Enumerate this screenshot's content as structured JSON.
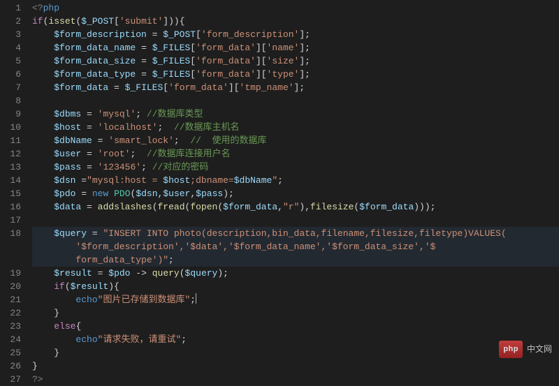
{
  "lines": [
    {
      "n": "1",
      "h": "<span class='tag'>&lt;?</span><span class='kw'>php</span>"
    },
    {
      "n": "2",
      "h": "<span class='ctrl'>if</span><span class='pun'>(</span><span class='func'>isset</span><span class='pun'>(</span><span class='var'>$_POST</span><span class='pun'>[</span><span class='str'>'submit'</span><span class='pun'>])){</span>"
    },
    {
      "n": "3",
      "h": "    <span class='var'>$form_description</span> <span class='op'>=</span> <span class='var'>$_POST</span><span class='pun'>[</span><span class='str'>'form_description'</span><span class='pun'>];</span>"
    },
    {
      "n": "4",
      "h": "    <span class='var'>$form_data_name</span> <span class='op'>=</span> <span class='var'>$_FILES</span><span class='pun'>[</span><span class='str'>'form_data'</span><span class='pun'>][</span><span class='str'>'name'</span><span class='pun'>];</span>"
    },
    {
      "n": "5",
      "h": "    <span class='var'>$form_data_size</span> <span class='op'>=</span> <span class='var'>$_FILES</span><span class='pun'>[</span><span class='str'>'form_data'</span><span class='pun'>][</span><span class='str'>'size'</span><span class='pun'>];</span>"
    },
    {
      "n": "6",
      "h": "    <span class='var'>$form_data_type</span> <span class='op'>=</span> <span class='var'>$_FILES</span><span class='pun'>[</span><span class='str'>'form_data'</span><span class='pun'>][</span><span class='str'>'type'</span><span class='pun'>];</span>"
    },
    {
      "n": "7",
      "h": "    <span class='var'>$form_data</span> <span class='op'>=</span> <span class='var'>$_FILES</span><span class='pun'>[</span><span class='str'>'form_data'</span><span class='pun'>][</span><span class='str'>'tmp_name'</span><span class='pun'>];</span>"
    },
    {
      "n": "8",
      "h": ""
    },
    {
      "n": "9",
      "h": "    <span class='var'>$dbms</span> <span class='op'>=</span> <span class='str'>'mysql'</span><span class='pun'>;</span> <span class='cmt'>//数据库类型</span>"
    },
    {
      "n": "10",
      "h": "    <span class='var'>$host</span> <span class='op'>=</span> <span class='str'>'localhost'</span><span class='pun'>;</span>  <span class='cmt'>//数据库主机名</span>"
    },
    {
      "n": "11",
      "h": "    <span class='var'>$dbName</span> <span class='op'>=</span> <span class='str'>'smart_lock'</span><span class='pun'>;</span>  <span class='cmt'>//  使用的数据库</span>"
    },
    {
      "n": "12",
      "h": "    <span class='var'>$user</span> <span class='op'>=</span> <span class='str'>'root'</span><span class='pun'>;</span>  <span class='cmt'>//数据库连接用户名</span>"
    },
    {
      "n": "13",
      "h": "    <span class='var'>$pass</span> <span class='op'>=</span> <span class='str'>'123456'</span><span class='pun'>;</span> <span class='cmt'>//对应的密码</span>"
    },
    {
      "n": "14",
      "h": "    <span class='var'>$dsn</span> <span class='op'>=</span><span class='str'>\"mysql:host = </span><span class='var'>$host</span><span class='str'>;dbname=</span><span class='var'>$dbName</span><span class='str'>\"</span><span class='pun'>;</span>"
    },
    {
      "n": "15",
      "h": "    <span class='var'>$pdo</span> <span class='op'>=</span> <span class='kw'>new</span> <span class='type'>PDO</span><span class='pun'>(</span><span class='var'>$dsn</span><span class='pun'>,</span><span class='var'>$user</span><span class='pun'>,</span><span class='var'>$pass</span><span class='pun'>);</span>"
    },
    {
      "n": "16",
      "h": "    <span class='var'>$data</span> <span class='op'>=</span> <span class='func'>addslashes</span><span class='pun'>(</span><span class='func'>fread</span><span class='pun'>(</span><span class='func'>fopen</span><span class='pun'>(</span><span class='var'>$form_data</span><span class='pun'>,</span><span class='str'>\"r\"</span><span class='pun'>),</span><span class='func'>filesize</span><span class='pun'>(</span><span class='var'>$form_data</span><span class='pun'>)));</span>"
    },
    {
      "n": "17",
      "h": ""
    },
    {
      "n": "18",
      "h": "    <span class='var'>$query</span> <span class='op'>=</span> <span class='str'>\"INSERT INTO photo(description,bin_data,filename,filesize,filetype)VALUES(</span>",
      "wrap": true
    },
    {
      "n": "",
      "h": "        <span class='str'>'$form_description','$data','$form_data_name','$form_data_size','$</span>",
      "wrap": true
    },
    {
      "n": "",
      "h": "        <span class='str'>form_data_type')\"</span><span class='pun'>;</span>",
      "wrap": true
    },
    {
      "n": "19",
      "h": "    <span class='var'>$result</span> <span class='op'>=</span> <span class='var'>$pdo</span> <span class='op'>-&gt;</span> <span class='func'>query</span><span class='pun'>(</span><span class='var'>$query</span><span class='pun'>);</span>"
    },
    {
      "n": "20",
      "h": "    <span class='ctrl'>if</span><span class='pun'>(</span><span class='var'>$result</span><span class='pun'>){</span>"
    },
    {
      "n": "21",
      "h": "        <span class='kw'>echo</span><span class='str'>\"图片已存储到数据库\"</span><span class='pun'>;</span><span class='cursor'></span>"
    },
    {
      "n": "22",
      "h": "    <span class='pun'>}</span>"
    },
    {
      "n": "23",
      "h": "    <span class='ctrl'>else</span><span class='pun'>{</span>"
    },
    {
      "n": "24",
      "h": "        <span class='kw'>echo</span><span class='str'>\"请求失败，请重试\"</span><span class='pun'>;</span>"
    },
    {
      "n": "25",
      "h": "    <span class='pun'>}</span>"
    },
    {
      "n": "26",
      "h": "<span class='pun'>}</span>"
    },
    {
      "n": "27",
      "h": "<span class='tag'>?&gt;</span>"
    }
  ],
  "watermark": {
    "badge": "php",
    "label": "中文网"
  }
}
